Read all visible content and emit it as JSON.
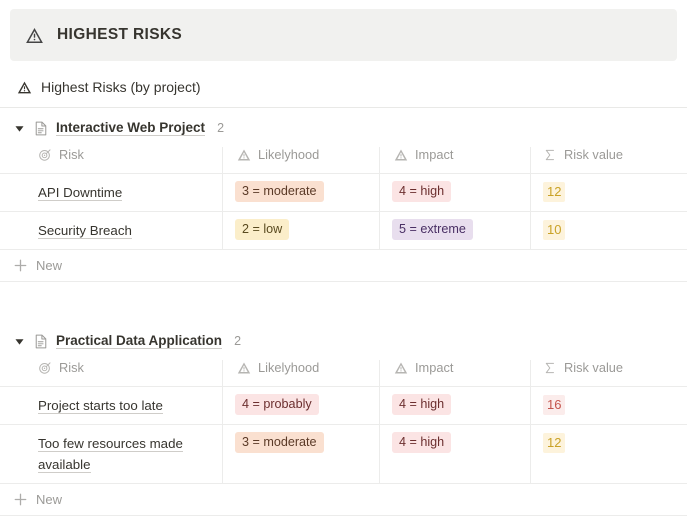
{
  "banner": {
    "icon": "warning-triangle-icon",
    "title": "HIGHEST RISKS",
    "background": "#f1f1ef"
  },
  "subheading": {
    "icon": "warning-triangle-icon",
    "text": "Highest Risks (by project)"
  },
  "columns": [
    {
      "label": "Risk",
      "icon": "target-icon"
    },
    {
      "label": "Likelyhood",
      "icon": "warning-triangle-icon"
    },
    {
      "label": "Impact",
      "icon": "warning-triangle-icon"
    },
    {
      "label": "Risk value",
      "icon": "sigma-sum-icon"
    }
  ],
  "new_row": {
    "label": "New",
    "icon": "plus-icon"
  },
  "groups": [
    {
      "name": "Interactive Web Project",
      "count": "2",
      "icon": "page-document-icon",
      "collapsed": false,
      "rows": [
        {
          "risk": "API Downtime",
          "likelyhood": "3 = moderate",
          "likelyhood_color": "#fae0d0",
          "likelyhood_text_color": "#5b3a27",
          "impact": "4 = high",
          "impact_color": "#fbe4e4",
          "impact_text_color": "#6b2e2e",
          "value": "12",
          "value_color": "#c9a227",
          "value_bg": "#fdf3dc"
        },
        {
          "risk": "Security Breach",
          "likelyhood": "2 = low",
          "likelyhood_color": "#fbeeca",
          "likelyhood_text_color": "#594a1f",
          "impact": "5 = extreme",
          "impact_color": "#e8deee",
          "impact_text_color": "#492f64",
          "value": "10",
          "value_color": "#c9a227",
          "value_bg": "#fdf3dc"
        }
      ]
    },
    {
      "name": "Practical Data Application",
      "count": "2",
      "icon": "page-document-icon",
      "collapsed": false,
      "rows": [
        {
          "risk": "Project starts too late",
          "likelyhood": "4 = probably",
          "likelyhood_color": "#fbe4e4",
          "likelyhood_text_color": "#6b2e2e",
          "impact": "4 = high",
          "impact_color": "#fbe4e4",
          "impact_text_color": "#6b2e2e",
          "value": "16",
          "value_color": "#c4554d",
          "value_bg": "#fbeceb"
        },
        {
          "risk": "Too few resources made available",
          "likelyhood": "3 = moderate",
          "likelyhood_color": "#fae0d0",
          "likelyhood_text_color": "#5b3a27",
          "impact": "4 = high",
          "impact_color": "#fbe4e4",
          "impact_text_color": "#6b2e2e",
          "value": "12",
          "value_color": "#c9a227",
          "value_bg": "#fdf3dc"
        }
      ]
    }
  ]
}
